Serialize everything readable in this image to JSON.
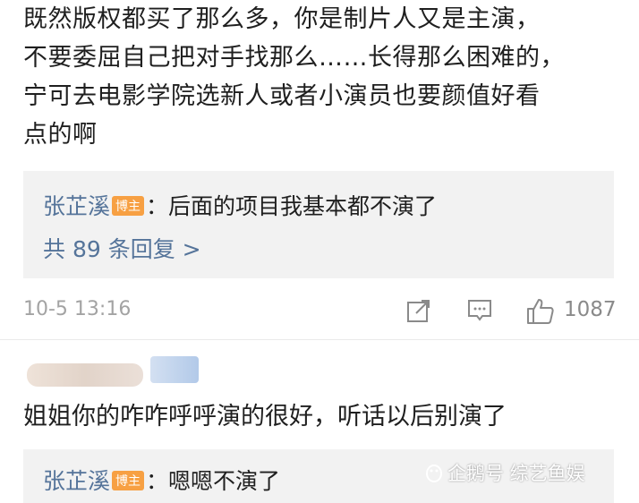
{
  "comment": {
    "lines": [
      "既然版权都买了那么多，你是制片人又是主演，",
      "不要委屈自己把对手找那么……长得那么困难的，",
      "宁可去电影学院选新人或者小演员也要颜值好看",
      "点的啊"
    ],
    "reply": {
      "author": "张芷溪",
      "badge": "博主",
      "text": "：后面的项目我基本都不演了",
      "more": "共 89 条回复 >"
    },
    "time": "10-5 13:16",
    "likes": "1087",
    "icons": [
      "share-icon",
      "comment-icon",
      "like-icon"
    ]
  },
  "comment2": {
    "text": "姐姐你的咋咋呼呼演的很好，听话以后别演了",
    "reply": {
      "author": "张芷溪",
      "badge": "博主",
      "text": "：嗯嗯不演了"
    }
  },
  "watermark": {
    "text": "企鹅号 综艺鱼娱"
  },
  "colors": {
    "link": "#55749a",
    "badge": "#f7a043",
    "reply_bg": "#f2f2f2",
    "meta": "#a3a3a3"
  }
}
